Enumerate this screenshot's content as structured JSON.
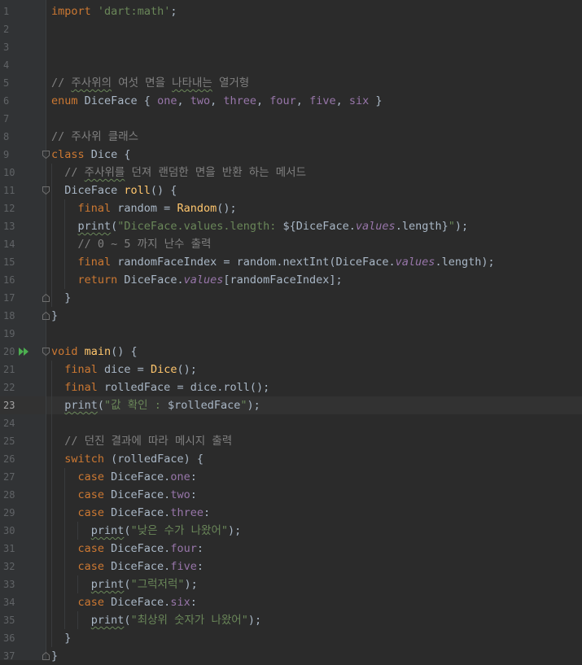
{
  "editor": {
    "current_line": 23,
    "lines": [
      {
        "n": "1",
        "html": "<span class=\"kw\">import</span> <span class=\"str\">'dart:math'</span>;"
      },
      {
        "n": "2",
        "html": ""
      },
      {
        "n": "3",
        "html": ""
      },
      {
        "n": "4",
        "html": ""
      },
      {
        "n": "5",
        "html": "<span class=\"cm\">// <span class=\"sq\">주사위의</span> 여섯 면을 <span class=\"sq\">나타내는</span> 열거형</span>"
      },
      {
        "n": "6",
        "html": "<span class=\"kw\">enum</span> DiceFace { <span class=\"en\">one</span>, <span class=\"en\">two</span>, <span class=\"en\">three</span>, <span class=\"en\">four</span>, <span class=\"en\">five</span>, <span class=\"en\">six</span> }"
      },
      {
        "n": "7",
        "html": ""
      },
      {
        "n": "8",
        "html": "<span class=\"cm\">// 주사위 클래스</span>"
      },
      {
        "n": "9",
        "html": "<span class=\"kw\">class</span> Dice {"
      },
      {
        "n": "10",
        "html": "  <span class=\"cm\">// <span class=\"sq\">주사위를</span> 던져 랜덤한 면을 반환 하는 메서드</span>"
      },
      {
        "n": "11",
        "html": "  DiceFace <span class=\"fn\">roll</span>() {"
      },
      {
        "n": "12",
        "html": "    <span class=\"kw\">final</span> random = <span class=\"fn\">Random</span>();"
      },
      {
        "n": "13",
        "html": "    <span class=\"sq\">print</span>(<span class=\"str\">\"DiceFace.values.length: </span>${DiceFace.<span class=\"sf\">values</span>.length}<span class=\"str\">\"</span>);"
      },
      {
        "n": "14",
        "html": "    <span class=\"cm\">// 0 ~ 5 까지 난수 출력</span>"
      },
      {
        "n": "15",
        "html": "    <span class=\"kw\">final</span> randomFaceIndex = random.nextInt(DiceFace.<span class=\"sf\">values</span>.length);"
      },
      {
        "n": "16",
        "html": "    <span class=\"kw\">return</span> DiceFace.<span class=\"sf\">values</span>[randomFaceIndex];"
      },
      {
        "n": "17",
        "html": "  }"
      },
      {
        "n": "18",
        "html": "}"
      },
      {
        "n": "19",
        "html": ""
      },
      {
        "n": "20",
        "html": "<span class=\"kw\">void</span> <span class=\"fn\">main</span>() {"
      },
      {
        "n": "21",
        "html": "  <span class=\"kw\">final</span> dice = <span class=\"fn\">Dice</span>();"
      },
      {
        "n": "22",
        "html": "  <span class=\"kw\">final</span> rolledFace = dice.roll();"
      },
      {
        "n": "23",
        "html": "  <span class=\"sq\">print</span>(<span class=\"str\">\"값 확인 : </span>$rolledFace<span class=\"str\">\"</span>);"
      },
      {
        "n": "24",
        "html": ""
      },
      {
        "n": "25",
        "html": "  <span class=\"cm\">// 던진 결과에 따라 메시지 출력</span>"
      },
      {
        "n": "26",
        "html": "  <span class=\"kw\">switch</span> (rolledFace) {"
      },
      {
        "n": "27",
        "html": "    <span class=\"kw\">case</span> DiceFace.<span class=\"en\">one</span>:"
      },
      {
        "n": "28",
        "html": "    <span class=\"kw\">case</span> DiceFace.<span class=\"en\">two</span>:"
      },
      {
        "n": "29",
        "html": "    <span class=\"kw\">case</span> DiceFace.<span class=\"en\">three</span>:"
      },
      {
        "n": "30",
        "html": "      <span class=\"sq\">print</span>(<span class=\"str\">\"낮은 수가 나왔어\"</span>);"
      },
      {
        "n": "31",
        "html": "    <span class=\"kw\">case</span> DiceFace.<span class=\"en\">four</span>:"
      },
      {
        "n": "32",
        "html": "    <span class=\"kw\">case</span> DiceFace.<span class=\"en\">five</span>:"
      },
      {
        "n": "33",
        "html": "      <span class=\"sq\">print</span>(<span class=\"str\">\"그럭저럭\"</span>);"
      },
      {
        "n": "34",
        "html": "    <span class=\"kw\">case</span> DiceFace.<span class=\"en\">six</span>:"
      },
      {
        "n": "35",
        "html": "      <span class=\"sq\">print</span>(<span class=\"str\">\"최상위 숫자가 나왔어\"</span>);"
      },
      {
        "n": "36",
        "html": "  }"
      },
      {
        "n": "37",
        "html": "}"
      }
    ]
  },
  "gutter": {
    "run_icon": "run-double-arrow-icon",
    "run_icon_color": "#4caf50",
    "fold_icon": "fold-marker-icon"
  },
  "colors": {
    "background": "#2b2b2b",
    "keyword": "#cc7832",
    "string": "#6a8759",
    "comment": "#808080",
    "function": "#ffc66d",
    "enum_constant": "#9876aa",
    "text": "#a9b7c6"
  }
}
